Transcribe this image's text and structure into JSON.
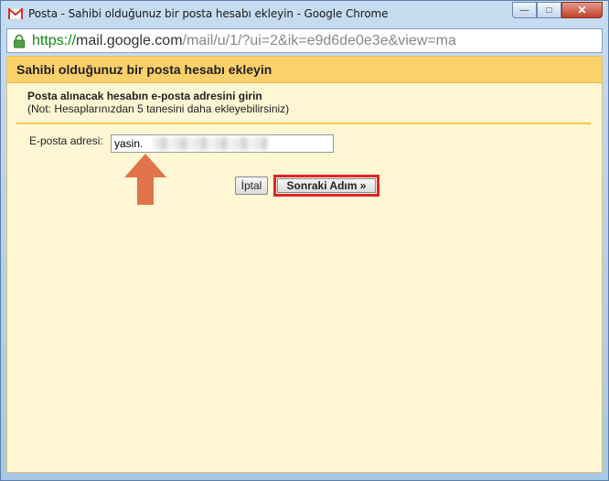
{
  "window": {
    "title": "Posta - Sahibi olduğunuz bir posta hesabı ekleyin - Google Chrome",
    "buttons": {
      "minimize": "—",
      "maximize": "□",
      "close": "✕"
    }
  },
  "address_bar": {
    "scheme": "https://",
    "domain": "mail.google.com",
    "path": "/mail/u/1/?ui=2&ik=e9d6de0e3e&view=ma"
  },
  "dialog": {
    "title": "Sahibi olduğunuz bir posta hesabı ekleyin",
    "instruction": "Posta alınacak hesabın e-posta adresini girin",
    "note": "(Not: Hesaplarınızdan 5 tanesini daha ekleyebilirsiniz)",
    "email_label": "E-posta adresi:",
    "email_value": "yasin.",
    "cancel_label": "İptal",
    "next_label": "Sonraki Adım »"
  },
  "colors": {
    "header_bg": "#fcd06b",
    "content_bg": "#fff6d4",
    "highlight": "#e0232a",
    "arrow": "#e0744a"
  }
}
